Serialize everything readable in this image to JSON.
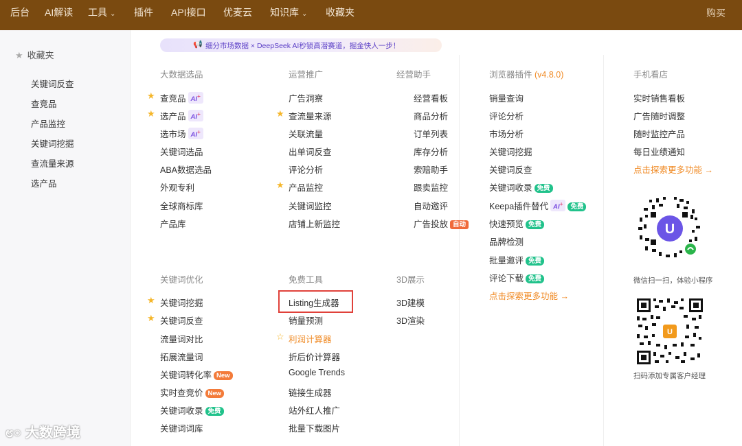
{
  "nav": {
    "items": [
      "后台",
      "AI解读",
      "工具",
      "插件",
      "API接口",
      "优麦云",
      "知识库",
      "收藏夹"
    ],
    "buy": "购买"
  },
  "sidebar": {
    "title": "收藏夹",
    "items": [
      "关键词反查",
      "查竞品",
      "产品监控",
      "关键词挖掘",
      "查流量来源",
      "选产品"
    ]
  },
  "banner": {
    "text": "细分市场数据 × DeepSeek AI秒锁高潜赛道，掘金快人一步！"
  },
  "columns": {
    "big_data": {
      "title": "大数据选品",
      "items": [
        "查竞品",
        "选产品",
        "选市场",
        "关键词选品",
        "ABA数据选品",
        "外观专利",
        "全球商标库",
        "产品库"
      ]
    },
    "operations": {
      "title": "运营推广",
      "items": [
        "广告洞察",
        "查流量来源",
        "关联流量",
        "出单词反查",
        "评论分析",
        "产品监控",
        "关键词监控",
        "店铺上新监控"
      ]
    },
    "assistant": {
      "title": "经营助手",
      "items": [
        "经营看板",
        "商品分析",
        "订单列表",
        "库存分析",
        "索赔助手",
        "跟卖监控",
        "自动邀评",
        "广告投放"
      ]
    },
    "plugin": {
      "title": "浏览器插件",
      "version": "(v4.8.0)",
      "items": [
        "销量查询",
        "评论分析",
        "市场分析",
        "关键词挖掘",
        "关键词反查",
        "关键词收录",
        "Keepa插件替代",
        "快速预览",
        "品牌检测",
        "批量邀评",
        "评论下载"
      ],
      "more": "点击探索更多功能 →"
    },
    "mobile": {
      "title": "手机看店",
      "items": [
        "实时销售看板",
        "广告随时调整",
        "随时监控产品",
        "每日业绩通知"
      ],
      "more": "点击探索更多功能 →",
      "qr1_label": "微信扫一扫，体验小程序",
      "qr2_label": "扫码添加专属客户经理"
    },
    "keyword": {
      "title": "关键词优化",
      "items": [
        "关键词挖掘",
        "关键词反查",
        "流量词对比",
        "拓展流量词",
        "关键词转化率",
        "实时查竞价",
        "关键词收录",
        "关键词词库"
      ]
    },
    "free_tools": {
      "title": "免费工具",
      "items": [
        "Listing生成器",
        "销量预测",
        "利润计算器",
        "折后价计算器",
        "Google Trends",
        "链接生成器",
        "站外红人推广",
        "批量下载图片"
      ]
    },
    "threed": {
      "title": "3D展示",
      "items": [
        "3D建模",
        "3D渲染"
      ]
    }
  },
  "badges": {
    "ai": "AI",
    "free": "免费",
    "new": "New",
    "auto": "自动"
  },
  "watermark": "大数跨境",
  "colors": {
    "topbar": "#7a4a10",
    "accent_orange": "#f08a24",
    "free_green": "#21c28b",
    "highlight_red": "#e0413a"
  }
}
